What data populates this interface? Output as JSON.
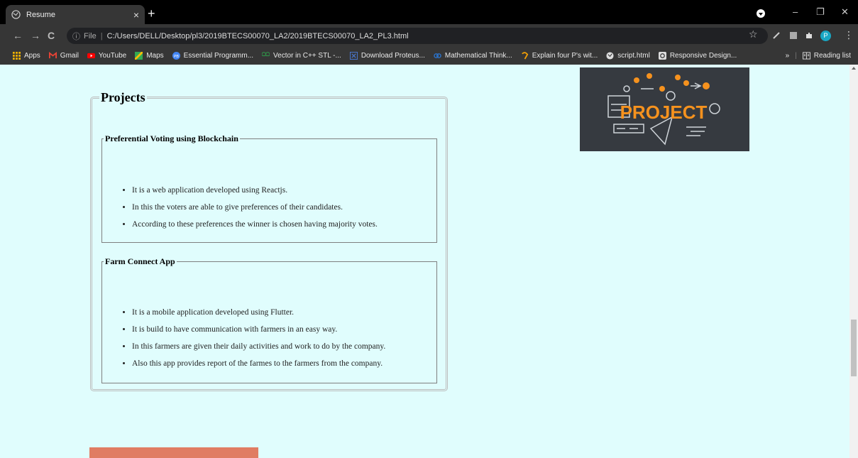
{
  "browser": {
    "tab_title": "Resume",
    "tab_close": "×",
    "new_tab": "+",
    "url_protocol_label": "File",
    "url": "C:/Users/DELL/Desktop/pl3/2019BTECS00070_LA2/2019BTECS00070_LA2_PL3.html",
    "avatar_letter": "P"
  },
  "bookmarks": [
    {
      "label": "Apps",
      "icon": "apps-grid-icon",
      "color": "#f4b400"
    },
    {
      "label": "Gmail",
      "icon": "gmail-icon",
      "color": "#ea4335"
    },
    {
      "label": "YouTube",
      "icon": "youtube-icon",
      "color": "#ff0000"
    },
    {
      "label": "Maps",
      "icon": "maps-icon",
      "color": "#34a853"
    },
    {
      "label": "Essential Programm...",
      "icon": "pb-icon",
      "color": "#4285f4"
    },
    {
      "label": "Vector in C++ STL -...",
      "icon": "gfg-icon",
      "color": "#2f8d46"
    },
    {
      "label": "Download Proteus...",
      "icon": "x-icon",
      "color": "#4a7ad6"
    },
    {
      "label": "Mathematical Think...",
      "icon": "coursera-icon",
      "color": "#2a73cc"
    },
    {
      "label": "Explain four P's wit...",
      "icon": "quora-icon",
      "color": "#f29f05"
    },
    {
      "label": "script.html",
      "icon": "globe-icon",
      "color": "#cccccc"
    },
    {
      "label": "Responsive Design...",
      "icon": "responsive-icon",
      "color": "#cccccc"
    }
  ],
  "bookmarks_more": "»",
  "reading_list": "Reading list",
  "page": {
    "projects_legend": "Projects",
    "projects": [
      {
        "title": "Preferential Voting using Blockchain",
        "points": [
          "It is a web application developed using Reactjs.",
          "In this the voters are able to give preferences of their candidates.",
          "According to these preferences the winner is chosen having majority votes."
        ]
      },
      {
        "title": "Farm Connect App",
        "points": [
          "It is a mobile application developed using Flutter.",
          "It is build to have communication with farmers in an easy way.",
          "In this farmers are given their daily activities and work to do by the company.",
          "Also this app provides report of the farmes to the farmers from the company."
        ]
      }
    ],
    "image_text": "PROJECT"
  },
  "colors": {
    "page_bg": "#e0fdfd",
    "salmon_box": "#e07d63",
    "image_accent": "#f6921e"
  }
}
